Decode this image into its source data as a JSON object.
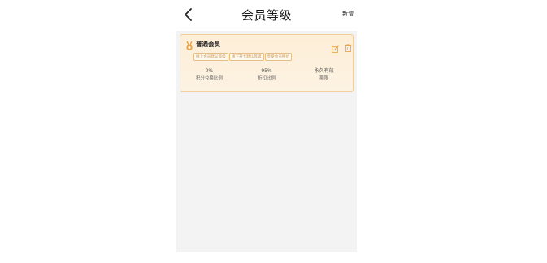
{
  "nav": {
    "title": "会员等级",
    "add_label": "新增"
  },
  "level_card": {
    "name": "普通会员",
    "tags": [
      "线上会员默认等级",
      "线下开卡默认等级",
      "享受会员特价"
    ],
    "stats": [
      {
        "value": "0%",
        "label": "积分兑换比例"
      },
      {
        "value": "95%",
        "label": "折扣比例"
      },
      {
        "value": "永久有效",
        "label": "期限"
      }
    ]
  },
  "colors": {
    "card_background": "#fdeed6",
    "card_border": "#f0cf9c",
    "accent": "#e8a64b",
    "tag_text": "#c99a5a"
  }
}
